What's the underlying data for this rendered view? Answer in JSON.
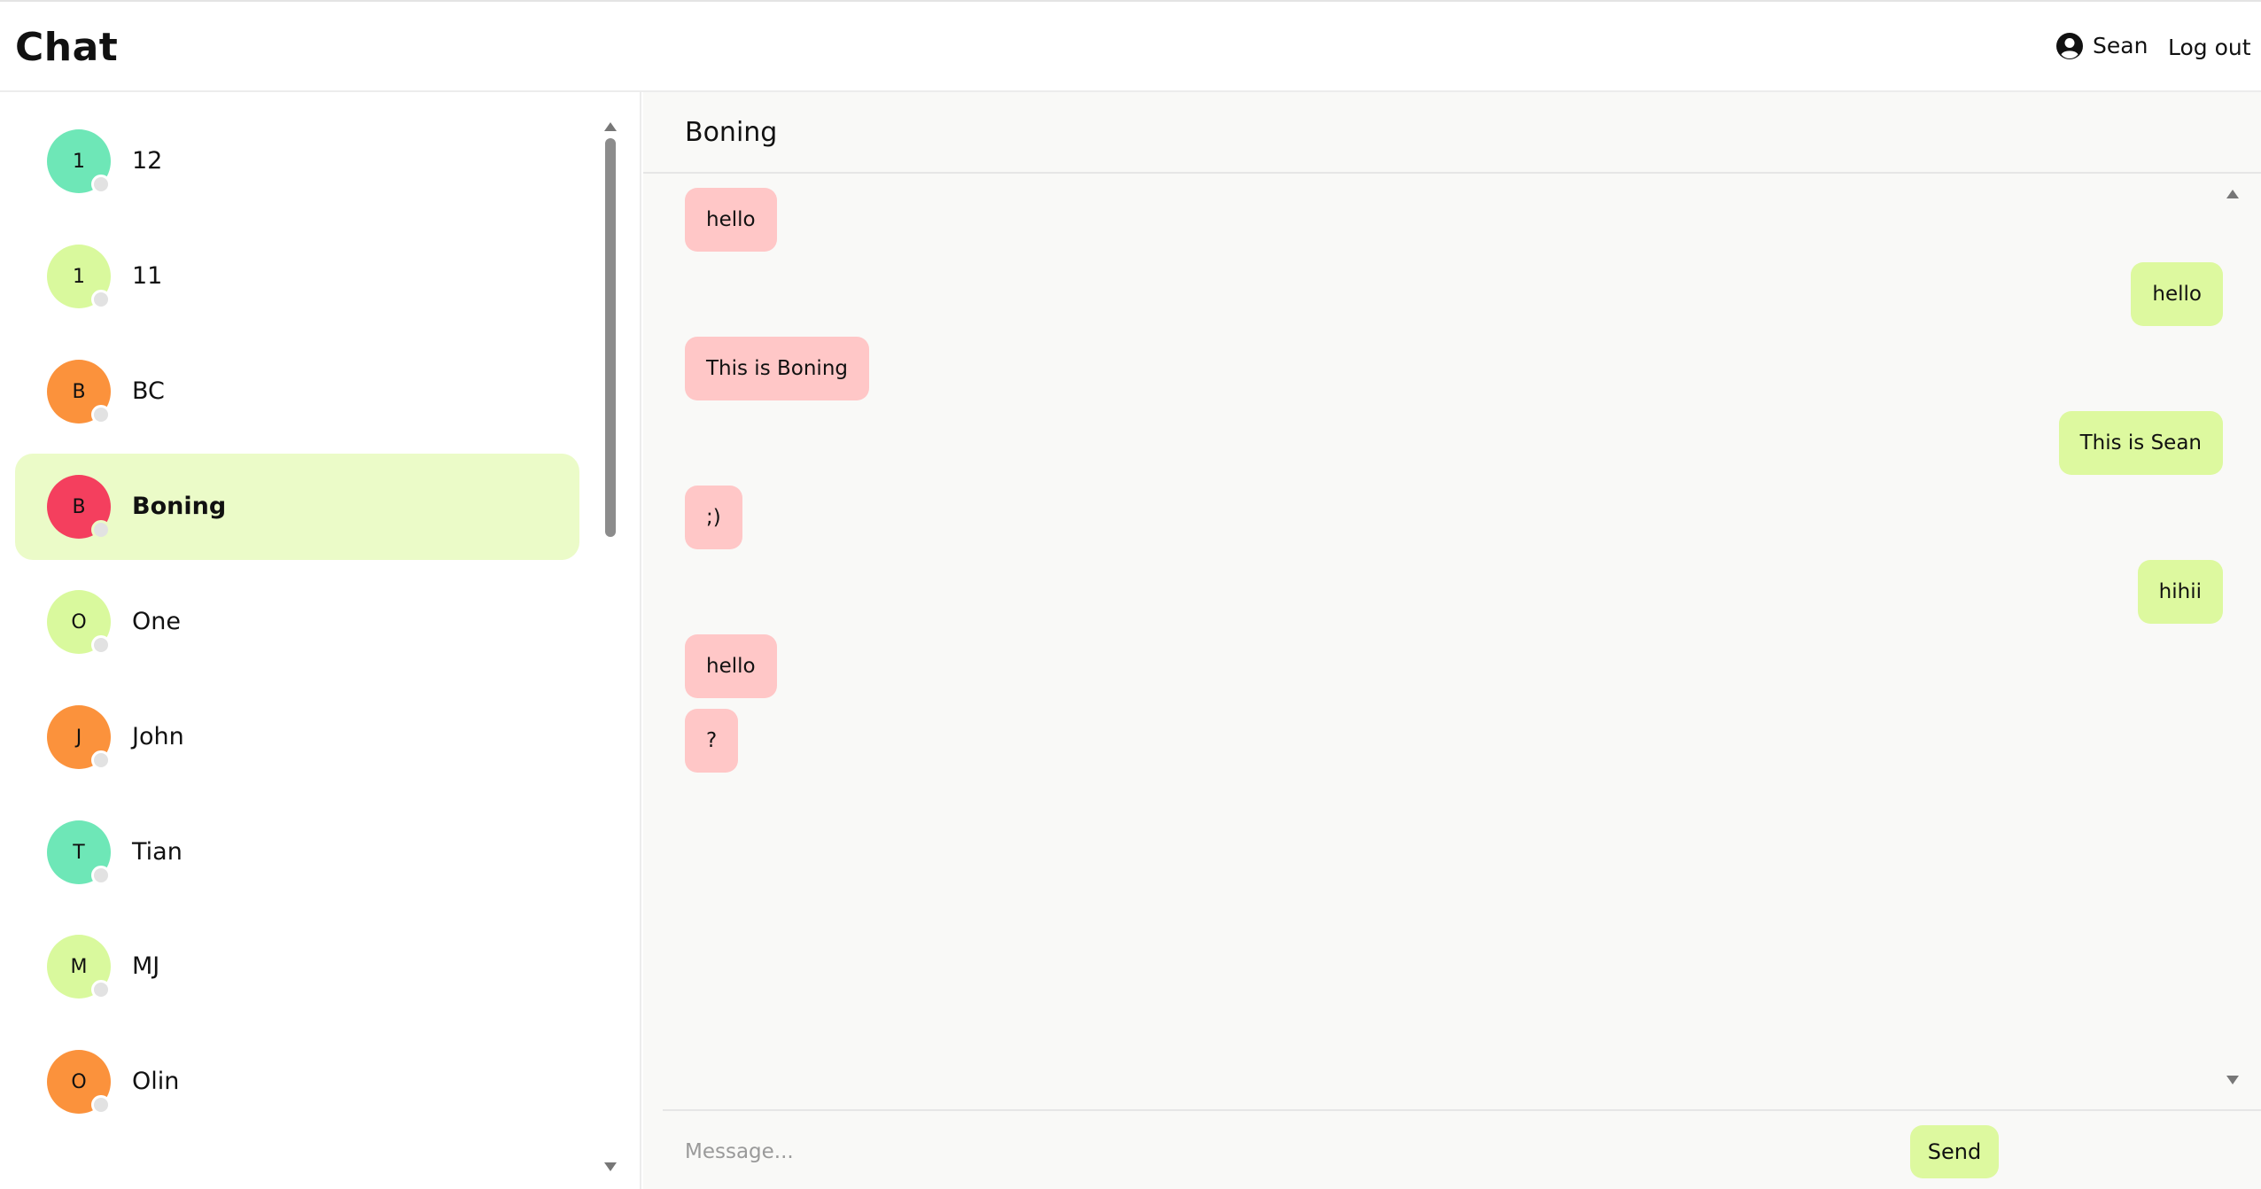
{
  "header": {
    "title": "Chat",
    "user_name": "Sean",
    "logout_label": "Log out"
  },
  "sidebar": {
    "contacts": [
      {
        "initial": "1",
        "name": "12",
        "color": "#6ee7b7",
        "active": false
      },
      {
        "initial": "1",
        "name": "11",
        "color": "#d9f99d",
        "active": false
      },
      {
        "initial": "B",
        "name": "BC",
        "color": "#fb923c",
        "active": false
      },
      {
        "initial": "B",
        "name": "Boning",
        "color": "#f43f5e",
        "active": true
      },
      {
        "initial": "O",
        "name": "One",
        "color": "#d9f99d",
        "active": false
      },
      {
        "initial": "J",
        "name": "John",
        "color": "#fb923c",
        "active": false
      },
      {
        "initial": "T",
        "name": "Tian",
        "color": "#6ee7b7",
        "active": false
      },
      {
        "initial": "M",
        "name": "MJ",
        "color": "#d9f99d",
        "active": false
      },
      {
        "initial": "O",
        "name": "Olin",
        "color": "#fb923c",
        "active": false
      }
    ]
  },
  "chat": {
    "title": "Boning",
    "messages": [
      {
        "text": "hello",
        "direction": "in"
      },
      {
        "text": "hello",
        "direction": "out"
      },
      {
        "text": "This is Boning",
        "direction": "in"
      },
      {
        "text": "This is Sean",
        "direction": "out"
      },
      {
        "text": ";)",
        "direction": "in"
      },
      {
        "text": "hihii",
        "direction": "out"
      },
      {
        "text": "hello",
        "direction": "in"
      },
      {
        "text": "?",
        "direction": "in"
      }
    ],
    "input_placeholder": "Message...",
    "input_value": "",
    "send_label": "Send"
  },
  "colors": {
    "incoming_bubble": "#ffc7c7",
    "outgoing_bubble": "#ddf99f",
    "active_contact": "#ebfbc8"
  }
}
